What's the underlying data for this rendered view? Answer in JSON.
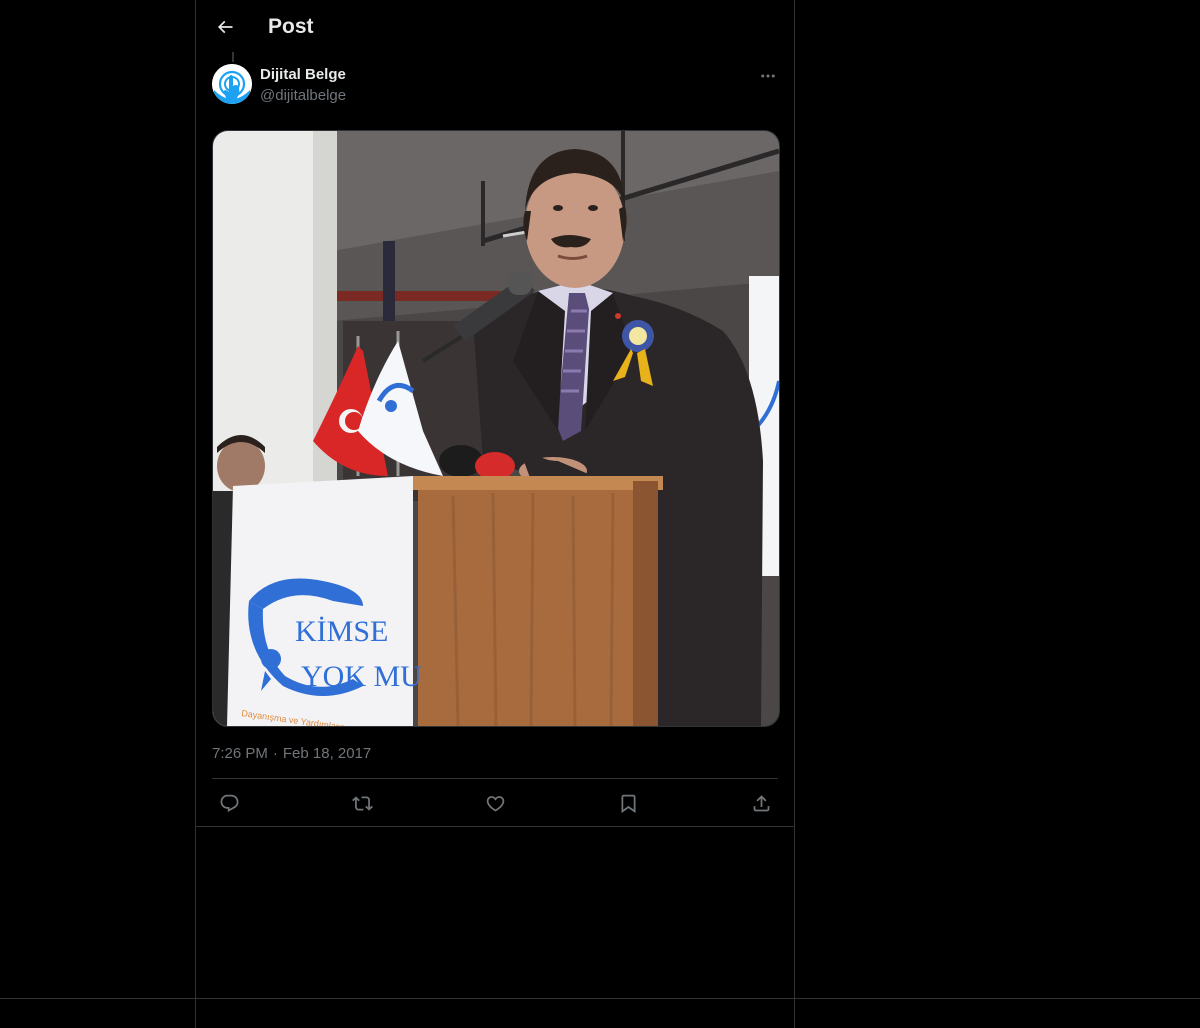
{
  "header": {
    "back_icon": "arrow-left-icon",
    "title": "Post"
  },
  "post": {
    "author": {
      "name": "Dijital Belge",
      "handle": "@dijitalbelge",
      "avatar_icon": "tap-hand-logo",
      "avatar_color": "#1da1f2"
    },
    "more_icon": "ellipsis-icon",
    "media": {
      "banner_text_line1": "KİMSE",
      "banner_text_line2": "YOK MU",
      "banner_subtext": "Dayanışma ve Yardımlaşma Derneği"
    },
    "time": "7:26 PM",
    "separator": "·",
    "date": "Feb 18, 2017"
  },
  "actions": [
    {
      "icon": "reply-icon"
    },
    {
      "icon": "retweet-icon"
    },
    {
      "icon": "like-icon"
    },
    {
      "icon": "bookmark-icon"
    },
    {
      "icon": "share-icon"
    }
  ],
  "colors": {
    "background": "#000000",
    "text_primary": "#e7e9ea",
    "text_secondary": "#71767b",
    "border": "#2f3336",
    "brand_blue": "#2f6fd6"
  }
}
